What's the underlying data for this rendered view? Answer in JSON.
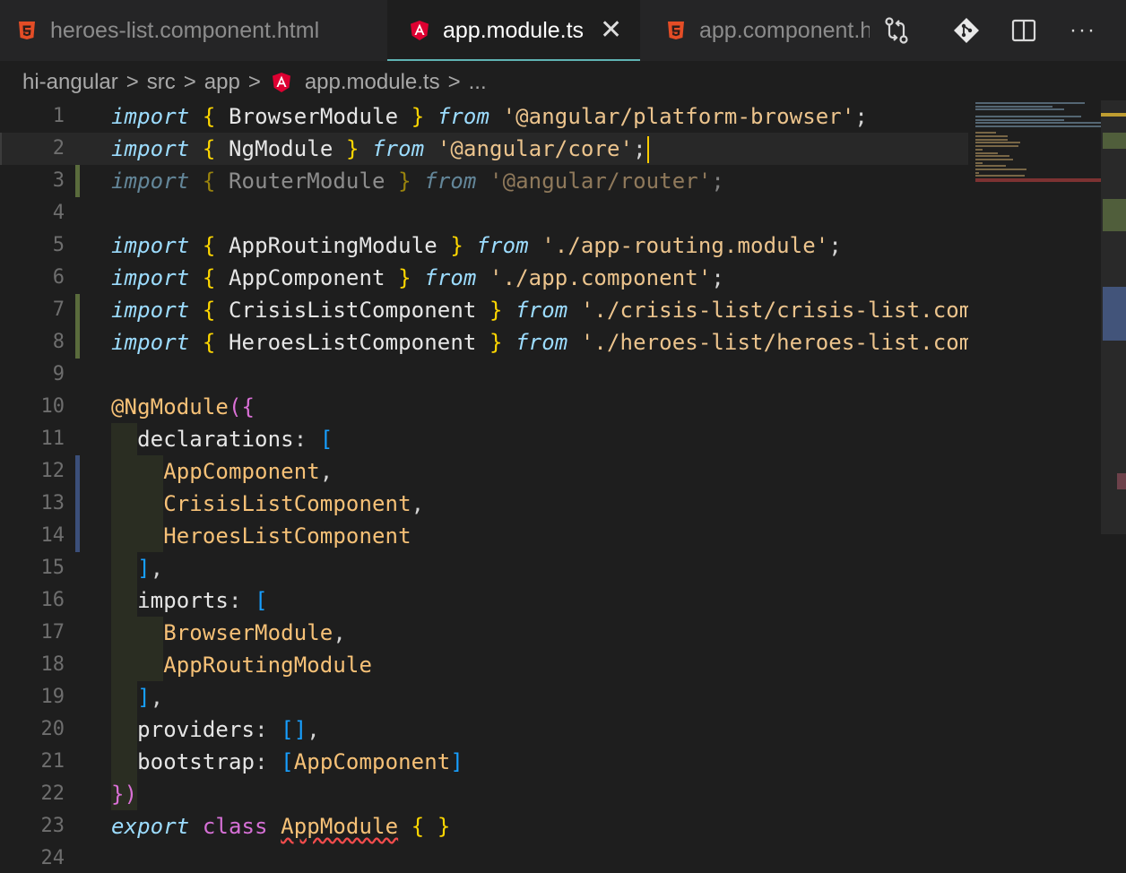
{
  "tabs": [
    {
      "label": "heroes-list.component.html",
      "icon": "html5-icon",
      "active": false
    },
    {
      "label": "app.module.ts",
      "icon": "angular-icon",
      "active": true
    },
    {
      "label": "app.component.h",
      "icon": "html5-icon",
      "active": false
    }
  ],
  "tab_close_glyph": "✕",
  "actions": [
    "compare-changes-icon",
    "git-icon",
    "split-editor-icon",
    "more-actions-icon"
  ],
  "more_glyph": "···",
  "breadcrumb": {
    "items": [
      "hi-angular",
      "src",
      "app",
      "app.module.ts",
      "..."
    ],
    "separator": ">"
  },
  "editor": {
    "line_numbers": [
      "1",
      "2",
      "3",
      "4",
      "5",
      "6",
      "7",
      "8",
      "9",
      "10",
      "11",
      "12",
      "13",
      "14",
      "15",
      "16",
      "17",
      "18",
      "19",
      "20",
      "21",
      "22",
      "23",
      "24"
    ],
    "current_line": 2,
    "lines": [
      "import { BrowserModule } from '@angular/platform-browser';",
      "import { NgModule } from '@angular/core';",
      "import { RouterModule } from '@angular/router';",
      "",
      "import { AppRoutingModule } from './app-routing.module';",
      "import { AppComponent } from './app.component';",
      "import { CrisisListComponent } from './crisis-list/crisis-list.comp",
      "import { HeroesListComponent } from './heroes-list/heroes-list.comp",
      "",
      "@NgModule({",
      "  declarations: [",
      "    AppComponent,",
      "    CrisisListComponent,",
      "    HeroesListComponent",
      "  ],",
      "  imports: [",
      "    BrowserModule,",
      "    AppRoutingModule",
      "  ],",
      "  providers: [],",
      "  bootstrap: [AppComponent]",
      "})",
      "export class AppModule { }",
      ""
    ]
  },
  "colors": {
    "background": "#1e1e1e",
    "tab_bar": "#252526",
    "active_tab_border": "#5fb4b4",
    "cursor": "#ffcc00",
    "gutter_modified": "#5a6b3c",
    "gutter_changed": "#3b4f7a",
    "error": "#f14c4c"
  }
}
